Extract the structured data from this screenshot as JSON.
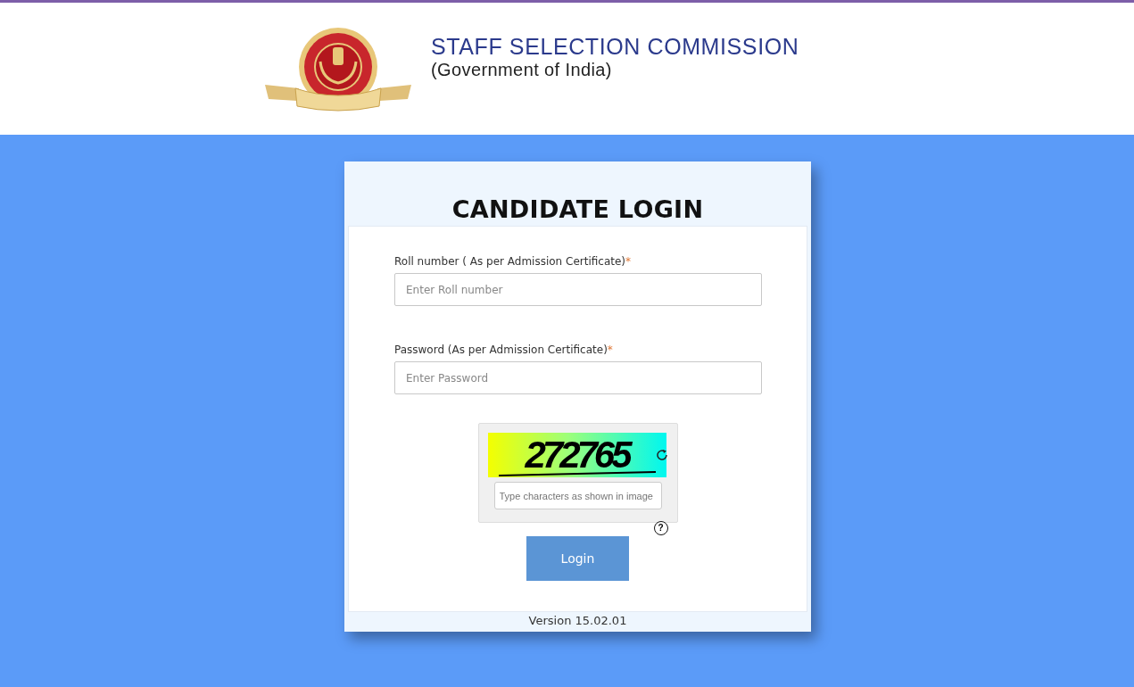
{
  "header": {
    "title": "STAFF SELECTION COMMISSION",
    "subtitle": "(Government of India)"
  },
  "login": {
    "title": "CANDIDATE LOGIN",
    "fields": [
      {
        "label": "Roll number ( As per Admission Certificate)",
        "required_mark": "*",
        "placeholder": "Enter Roll number"
      },
      {
        "label": "Password (As per Admission Certificate)",
        "required_mark": "*",
        "placeholder": "Enter Password"
      }
    ],
    "captcha": {
      "text": "272765",
      "placeholder": "Type characters as shown in image",
      "help": "?"
    },
    "button": "Login",
    "version": "Version 15.02.01"
  }
}
